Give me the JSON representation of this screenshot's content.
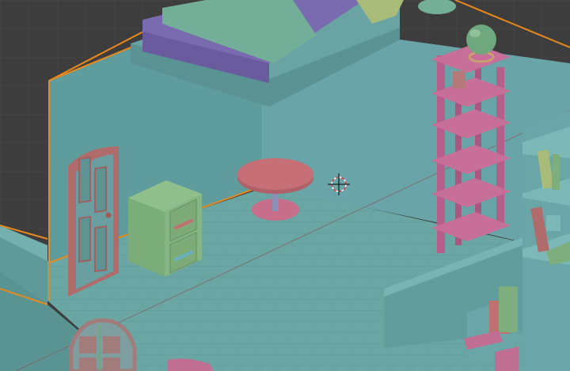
{
  "viewport": {
    "name": "3D Viewport",
    "background_color": "#3d3d3d",
    "grid_line_color": "#474747",
    "selection_outline_color": "#e8891c",
    "axis_line_color": "#8a5050"
  },
  "scene": {
    "objects": [
      {
        "id": "floor",
        "kind": "floor-tiles",
        "color": "#6aa6a4"
      },
      {
        "id": "back-wall",
        "kind": "wall",
        "color": "#69a4a8"
      },
      {
        "id": "loft-bed",
        "kind": "bed",
        "colors": {
          "mattress": "#7a6ab0",
          "blanket": "#72ae98",
          "pillow": "#a9bb78"
        }
      },
      {
        "id": "door",
        "kind": "door",
        "color": "#b06b6b"
      },
      {
        "id": "filing-cabinet",
        "kind": "cabinet",
        "color": "#7fae7e",
        "drawers": 2
      },
      {
        "id": "round-table",
        "kind": "table",
        "color": "#c76f76"
      },
      {
        "id": "tall-shelf",
        "kind": "shelf",
        "color": "#c06e92",
        "levels": 6
      },
      {
        "id": "globe",
        "kind": "globe",
        "color": "#6fa77e"
      },
      {
        "id": "bookcase-right",
        "kind": "bookshelf",
        "color": "#6aa6a8"
      },
      {
        "id": "window-lower",
        "kind": "window",
        "color": "#a17c7a"
      }
    ],
    "cursor_3d": {
      "icon": "3d-cursor-icon"
    }
  }
}
